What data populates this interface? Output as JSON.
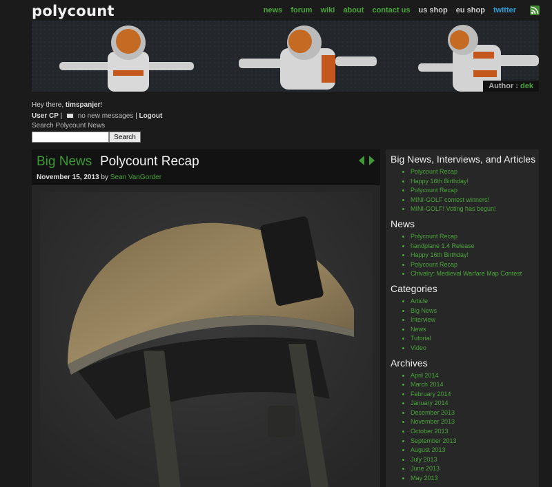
{
  "header": {
    "logo": "polycount",
    "nav": [
      {
        "label": "news",
        "color": "#4aa63a"
      },
      {
        "label": "forum",
        "color": "#4aa63a"
      },
      {
        "label": "wiki",
        "color": "#4aa63a"
      },
      {
        "label": "about",
        "color": "#4aa63a"
      },
      {
        "label": "contact us",
        "color": "#4aa63a"
      },
      {
        "label": "us shop",
        "color": "#cfcfcf"
      },
      {
        "label": "eu shop",
        "color": "#cfcfcf"
      },
      {
        "label": "twitter",
        "color": "#2aa3dc"
      }
    ],
    "rss_icon": "rss-icon"
  },
  "banner": {
    "author_label": "Author :",
    "author_name": "dek"
  },
  "user": {
    "greeting": "Hey there,",
    "username": "timspanjer",
    "bang": "!",
    "user_cp": "User CP",
    "messages": "no new messages",
    "logout": "Logout",
    "sep": "|"
  },
  "search": {
    "label": "Search Polycount News",
    "button": "Search",
    "value": ""
  },
  "post": {
    "category": "Big News",
    "title": "Polycount Recap",
    "date": "November 15, 2013",
    "by": "by",
    "author": "Sean VanGorder"
  },
  "sidebar": {
    "sections": [
      {
        "title": "Big News, Interviews, and Articles",
        "items": [
          "Polycount Recap",
          "Happy 16th Birthday!",
          "Polycount Recap",
          "MINI-GOLF contest winners!",
          "MINI-GOLF! Voting has begun!"
        ]
      },
      {
        "title": "News",
        "items": [
          "Polycount Recap",
          "handplane 1.4 Release",
          "Happy 16th Birthday!",
          "Polycount Recap",
          "Chivalry: Medieval Warfare Map Contest"
        ]
      },
      {
        "title": "Categories",
        "items": [
          "Article",
          "Big News",
          "Interview",
          "News",
          "Tutorial",
          "Video"
        ]
      },
      {
        "title": "Archives",
        "items": [
          "April 2014",
          "March 2014",
          "February 2014",
          "January 2014",
          "December 2013",
          "November 2013",
          "October 2013",
          "September 2013",
          "August 2013",
          "July 2013",
          "June 2013",
          "May 2013"
        ]
      }
    ]
  },
  "colors": {
    "accent": "#4aa63a",
    "background": "#1b1b1b",
    "twitter": "#2aa3dc"
  }
}
